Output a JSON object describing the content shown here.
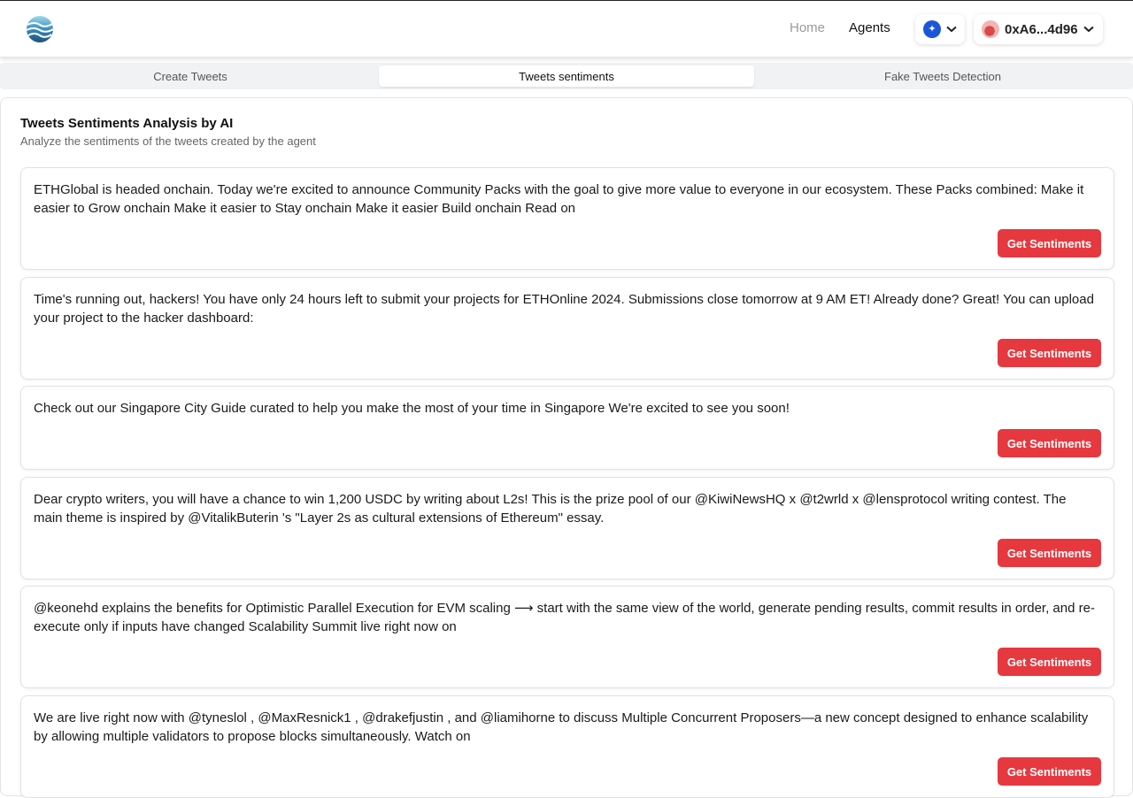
{
  "header": {
    "logo_icon": "wave-globe-logo-icon",
    "nav": {
      "home": "Home",
      "agents": "Agents"
    },
    "chain_icon": "network-icon",
    "wallet": {
      "address": "0xA6...4d96",
      "avatar_icon": "avatar-icon"
    }
  },
  "tabs": [
    {
      "label": "Create Tweets"
    },
    {
      "label": "Tweets sentiments"
    },
    {
      "label": "Fake Tweets Detection"
    }
  ],
  "panel": {
    "title": "Tweets Sentiments Analysis by AI",
    "subtitle": "Analyze the sentiments of the tweets created by the agent"
  },
  "tweets": [
    {
      "text": "ETHGlobal is headed onchain. Today we're excited to announce Community Packs with the goal to give more value to everyone in our ecosystem. These Packs combined: Make it easier to Grow onchain Make it easier to Stay onchain Make it easier Build onchain Read on",
      "button": "Get Sentiments"
    },
    {
      "text": "Time's running out, hackers! You have only 24 hours left to submit your projects for ETHOnline 2024. Submissions close tomorrow at 9 AM ET! Already done? Great! You can upload your project to the hacker dashboard:",
      "button": "Get Sentiments"
    },
    {
      "text": "Check out our Singapore City Guide curated to help you make the most of your time in Singapore We're excited to see you soon!",
      "button": "Get Sentiments"
    },
    {
      "text": "Dear crypto writers, you will have a chance to win 1,200 USDC by writing about L2s! This is the prize pool of our @KiwiNewsHQ x @t2wrld x @lensprotocol writing contest. The main theme is inspired by @VitalikButerin 's \"Layer 2s as cultural extensions of Ethereum\" essay.",
      "button": "Get Sentiments"
    },
    {
      "text": "@keonehd explains the benefits for Optimistic Parallel Execution for EVM scaling ⟶ start with the same view of the world, generate pending results, commit results in order, and re-execute only if inputs have changed Scalability Summit live right now on",
      "button": "Get Sentiments"
    },
    {
      "text": "We are live right now with @tyneslol , @MaxResnick1 , @drakefjustin , and @liamihorne to discuss Multiple Concurrent Proposers—a new concept designed to enhance scalability by allowing multiple validators to propose blocks simultaneously. Watch on",
      "button": "Get Sentiments"
    }
  ],
  "colors": {
    "accent_button": "#e5393f",
    "chain_blue": "#1a56db",
    "tab_bg": "#f1f2f4"
  }
}
